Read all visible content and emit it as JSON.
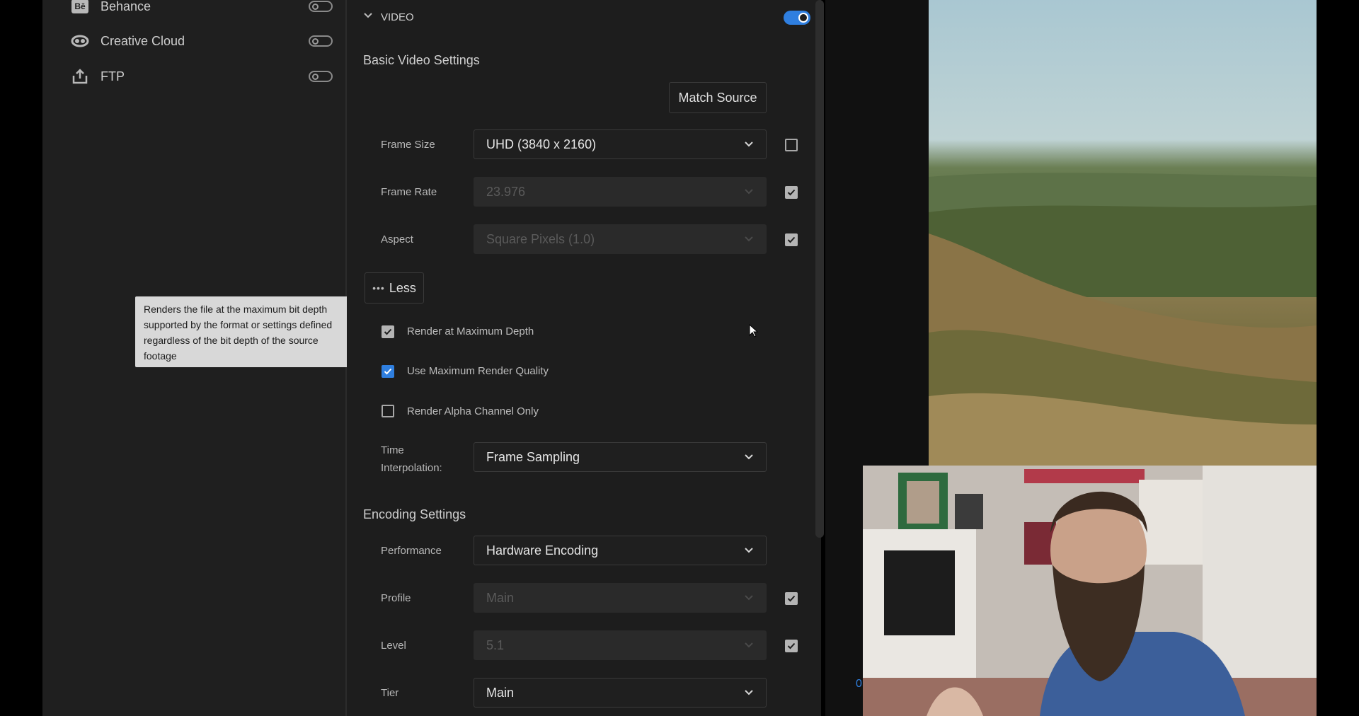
{
  "publish": {
    "destinations": [
      {
        "label": "Behance",
        "icon": "behance-icon",
        "enabled": false
      },
      {
        "label": "Creative Cloud",
        "icon": "creative-cloud-icon",
        "enabled": false
      },
      {
        "label": "FTP",
        "icon": "ftp-upload-icon",
        "enabled": false
      }
    ]
  },
  "video_section": {
    "header": "VIDEO",
    "enabled": true,
    "basic_title": "Basic Video Settings",
    "match_source_label": "Match Source",
    "frame_size": {
      "label": "Frame Size",
      "value": "UHD (3840 x 2160)",
      "match_checked": false
    },
    "frame_rate": {
      "label": "Frame Rate",
      "value": "23.976",
      "match_checked": true
    },
    "aspect": {
      "label": "Aspect",
      "value": "Square Pixels (1.0)",
      "match_checked": true
    },
    "less_label": "Less",
    "render_max_depth": {
      "label": "Render at Maximum Depth",
      "checked": true
    },
    "max_render_quality": {
      "label": "Use Maximum Render Quality",
      "checked": true
    },
    "alpha_only": {
      "label": "Render Alpha Channel Only",
      "checked": false
    },
    "time_interp": {
      "label_line1": "Time",
      "label_line2": "Interpolation:",
      "value": "Frame Sampling"
    }
  },
  "encoding_section": {
    "title": "Encoding Settings",
    "performance": {
      "label": "Performance",
      "value": "Hardware Encoding"
    },
    "profile": {
      "label": "Profile",
      "value": "Main",
      "match_checked": true
    },
    "level": {
      "label": "Level",
      "value": "5.1",
      "match_checked": true
    },
    "tier": {
      "label": "Tier",
      "value": "Main"
    }
  },
  "tooltip": {
    "text": "Renders the file at the maximum bit depth supported by the format or settings defined regardless of the bit depth of the source footage"
  },
  "timeline_marker": "0",
  "colors": {
    "accent": "#2f7fe0",
    "panel": "#1d1d1d",
    "tooltip_bg": "#d8d8d8"
  }
}
